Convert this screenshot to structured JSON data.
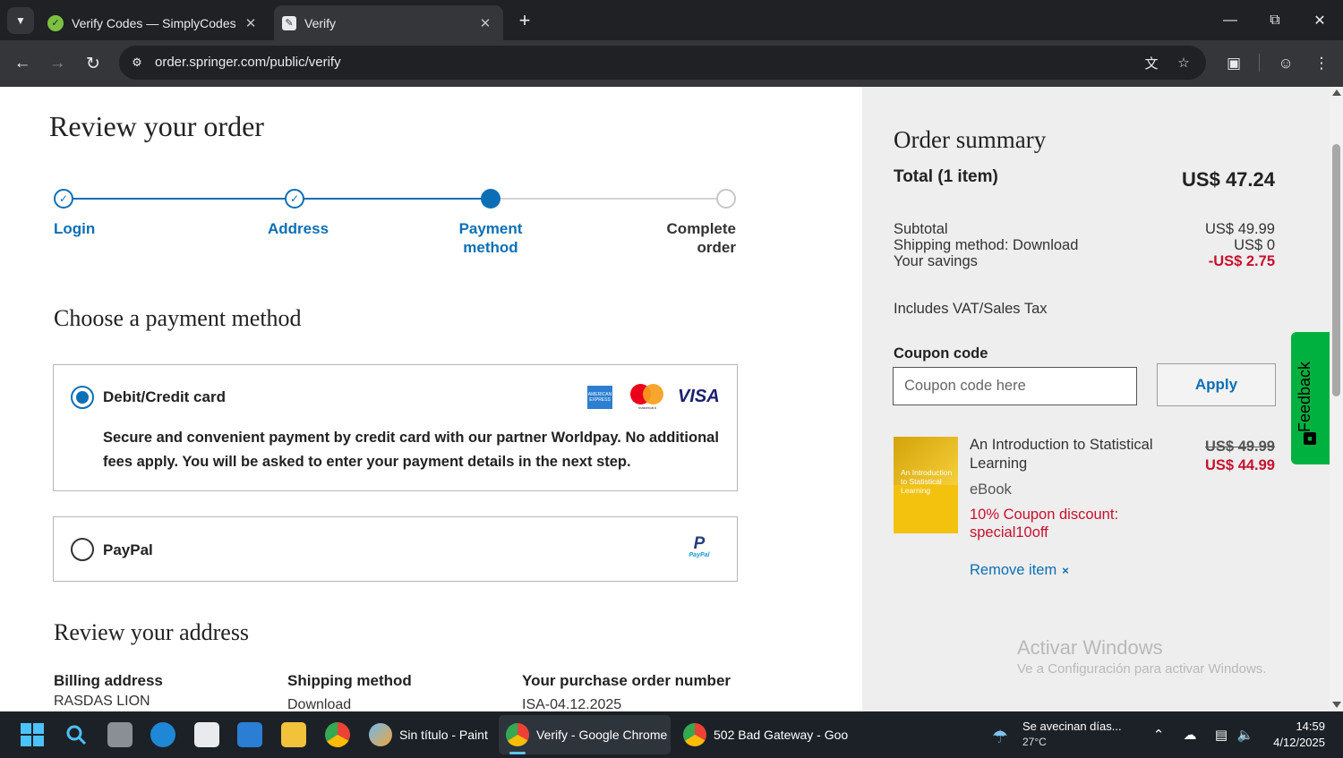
{
  "browser": {
    "tabs": [
      {
        "title": "Verify Codes — SimplyCodes",
        "active": false,
        "icon": "simplycodes-icon"
      },
      {
        "title": "Verify",
        "active": true,
        "icon": "springer-page-icon"
      }
    ],
    "url": "order.springer.com/public/verify"
  },
  "page": {
    "title": "Review your order",
    "stepper": [
      {
        "label": "Login",
        "state": "done"
      },
      {
        "label": "Address",
        "state": "done"
      },
      {
        "label": "Payment method",
        "state": "current"
      },
      {
        "label": "Complete order",
        "state": "todo"
      }
    ],
    "payment": {
      "heading": "Choose a payment method",
      "options": [
        {
          "label": "Debit/Credit card",
          "selected": true,
          "description": "Secure and convenient payment by credit card with our partner Worldpay. No additional fees apply. You will be asked to enter your payment details in the next step.",
          "logos": [
            "amex-logo",
            "mastercard-logo",
            "visa-logo"
          ],
          "mastercard_text": "mastercard",
          "visa_text": "VISA"
        },
        {
          "label": "PayPal",
          "selected": false,
          "logos": [
            "paypal-logo"
          ],
          "paypal_mark": "P",
          "paypal_text": "PayPal"
        }
      ]
    },
    "address": {
      "heading": "Review your address",
      "billing_label": "Billing address",
      "billing_value": "RASDAS LION",
      "shipping_label": "Shipping method",
      "shipping_value": "Download",
      "po_label": "Your purchase order number",
      "po_value": "ISA-04.12.2025"
    }
  },
  "summary": {
    "title": "Order summary",
    "total_label": "Total (1 item)",
    "total_value": "US$ 47.24",
    "rows": [
      {
        "label": "Subtotal",
        "value": "US$ 49.99"
      },
      {
        "label": "Shipping method: Download",
        "value": "US$ 0"
      },
      {
        "label": "Your savings",
        "value": "-US$ 2.75"
      }
    ],
    "vat_note": "Includes VAT/Sales Tax",
    "coupon_label": "Coupon code",
    "coupon_placeholder": "Coupon code here",
    "apply_label": "Apply",
    "item": {
      "title": "An Introduction to Statistical Learning",
      "cover_title": "An Introduction to Statistical Learning",
      "type": "eBook",
      "discount": "10% Coupon discount: special10off",
      "old_price": "US$ 49.99",
      "new_price": "US$ 44.99",
      "remove_label": "Remove item",
      "remove_icon": "×"
    }
  },
  "feedback_label": "Feedback",
  "watermark": {
    "line1": "Activar Windows",
    "line2": "Ve a Configuración para activar Windows."
  },
  "taskbar": {
    "apps": [
      {
        "label": "Sin título - Paint",
        "icon": "paint-icon"
      },
      {
        "label": "Verify - Google Chrome",
        "icon": "chrome-icon",
        "active": true
      },
      {
        "label": "502 Bad Gateway - Goo",
        "icon": "chrome-icon"
      }
    ],
    "weather_text": "Se avecinan días...",
    "weather_temp": "27°C",
    "time": "14:59",
    "date": "4/12/2025"
  },
  "colors": {
    "accent": "#0c6fb6",
    "discount_red": "#c8102e",
    "summary_bg": "#eeeeee",
    "feedback_green": "#00b140"
  }
}
